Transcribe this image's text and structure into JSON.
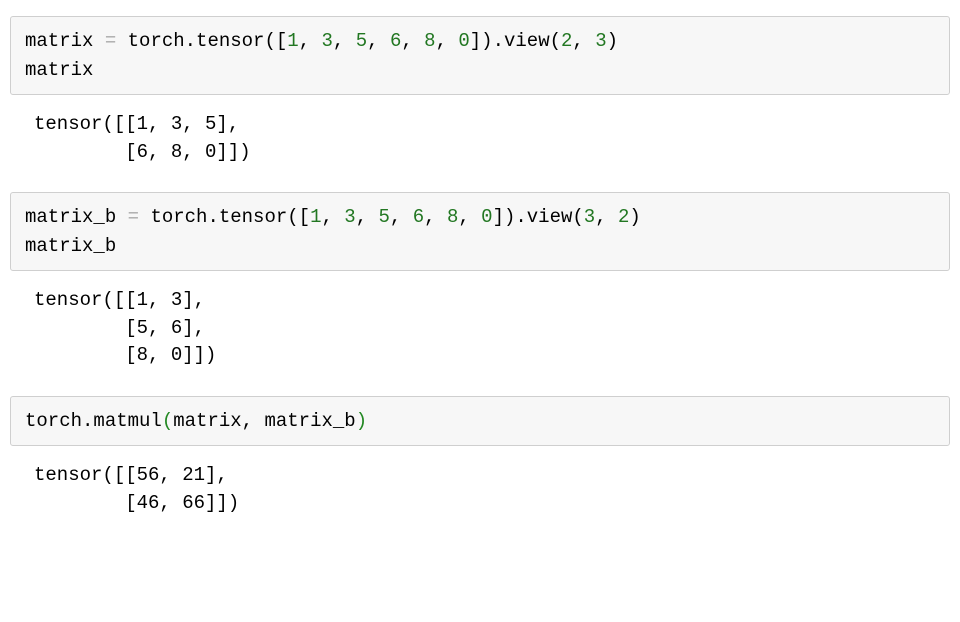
{
  "cell1": {
    "var": "matrix",
    "eq": " = ",
    "call_prefix": "torch.tensor([",
    "vals": [
      "1",
      "3",
      "5",
      "6",
      "8",
      "0"
    ],
    "sep": ", ",
    "call_mid": "]).view(",
    "arg1": "2",
    "arg2": "3",
    "call_end": ")",
    "line2": "matrix"
  },
  "out1": "tensor([[1, 3, 5],\n        [6, 8, 0]])",
  "cell2": {
    "var": "matrix_b",
    "eq": " = ",
    "call_prefix": "torch.tensor([",
    "vals": [
      "1",
      "3",
      "5",
      "6",
      "8",
      "0"
    ],
    "sep": ", ",
    "call_mid": "]).view(",
    "arg1": "3",
    "arg2": "2",
    "call_end": ")",
    "line2": "matrix_b"
  },
  "out2": "tensor([[1, 3],\n        [5, 6],\n        [8, 0]])",
  "cell3": {
    "prefix": "torch.matmul",
    "open": "(",
    "arg1": "matrix",
    "sep": ", ",
    "arg2": "matrix_b",
    "close": ")"
  },
  "out3": "tensor([[56, 21],\n        [46, 66]])"
}
